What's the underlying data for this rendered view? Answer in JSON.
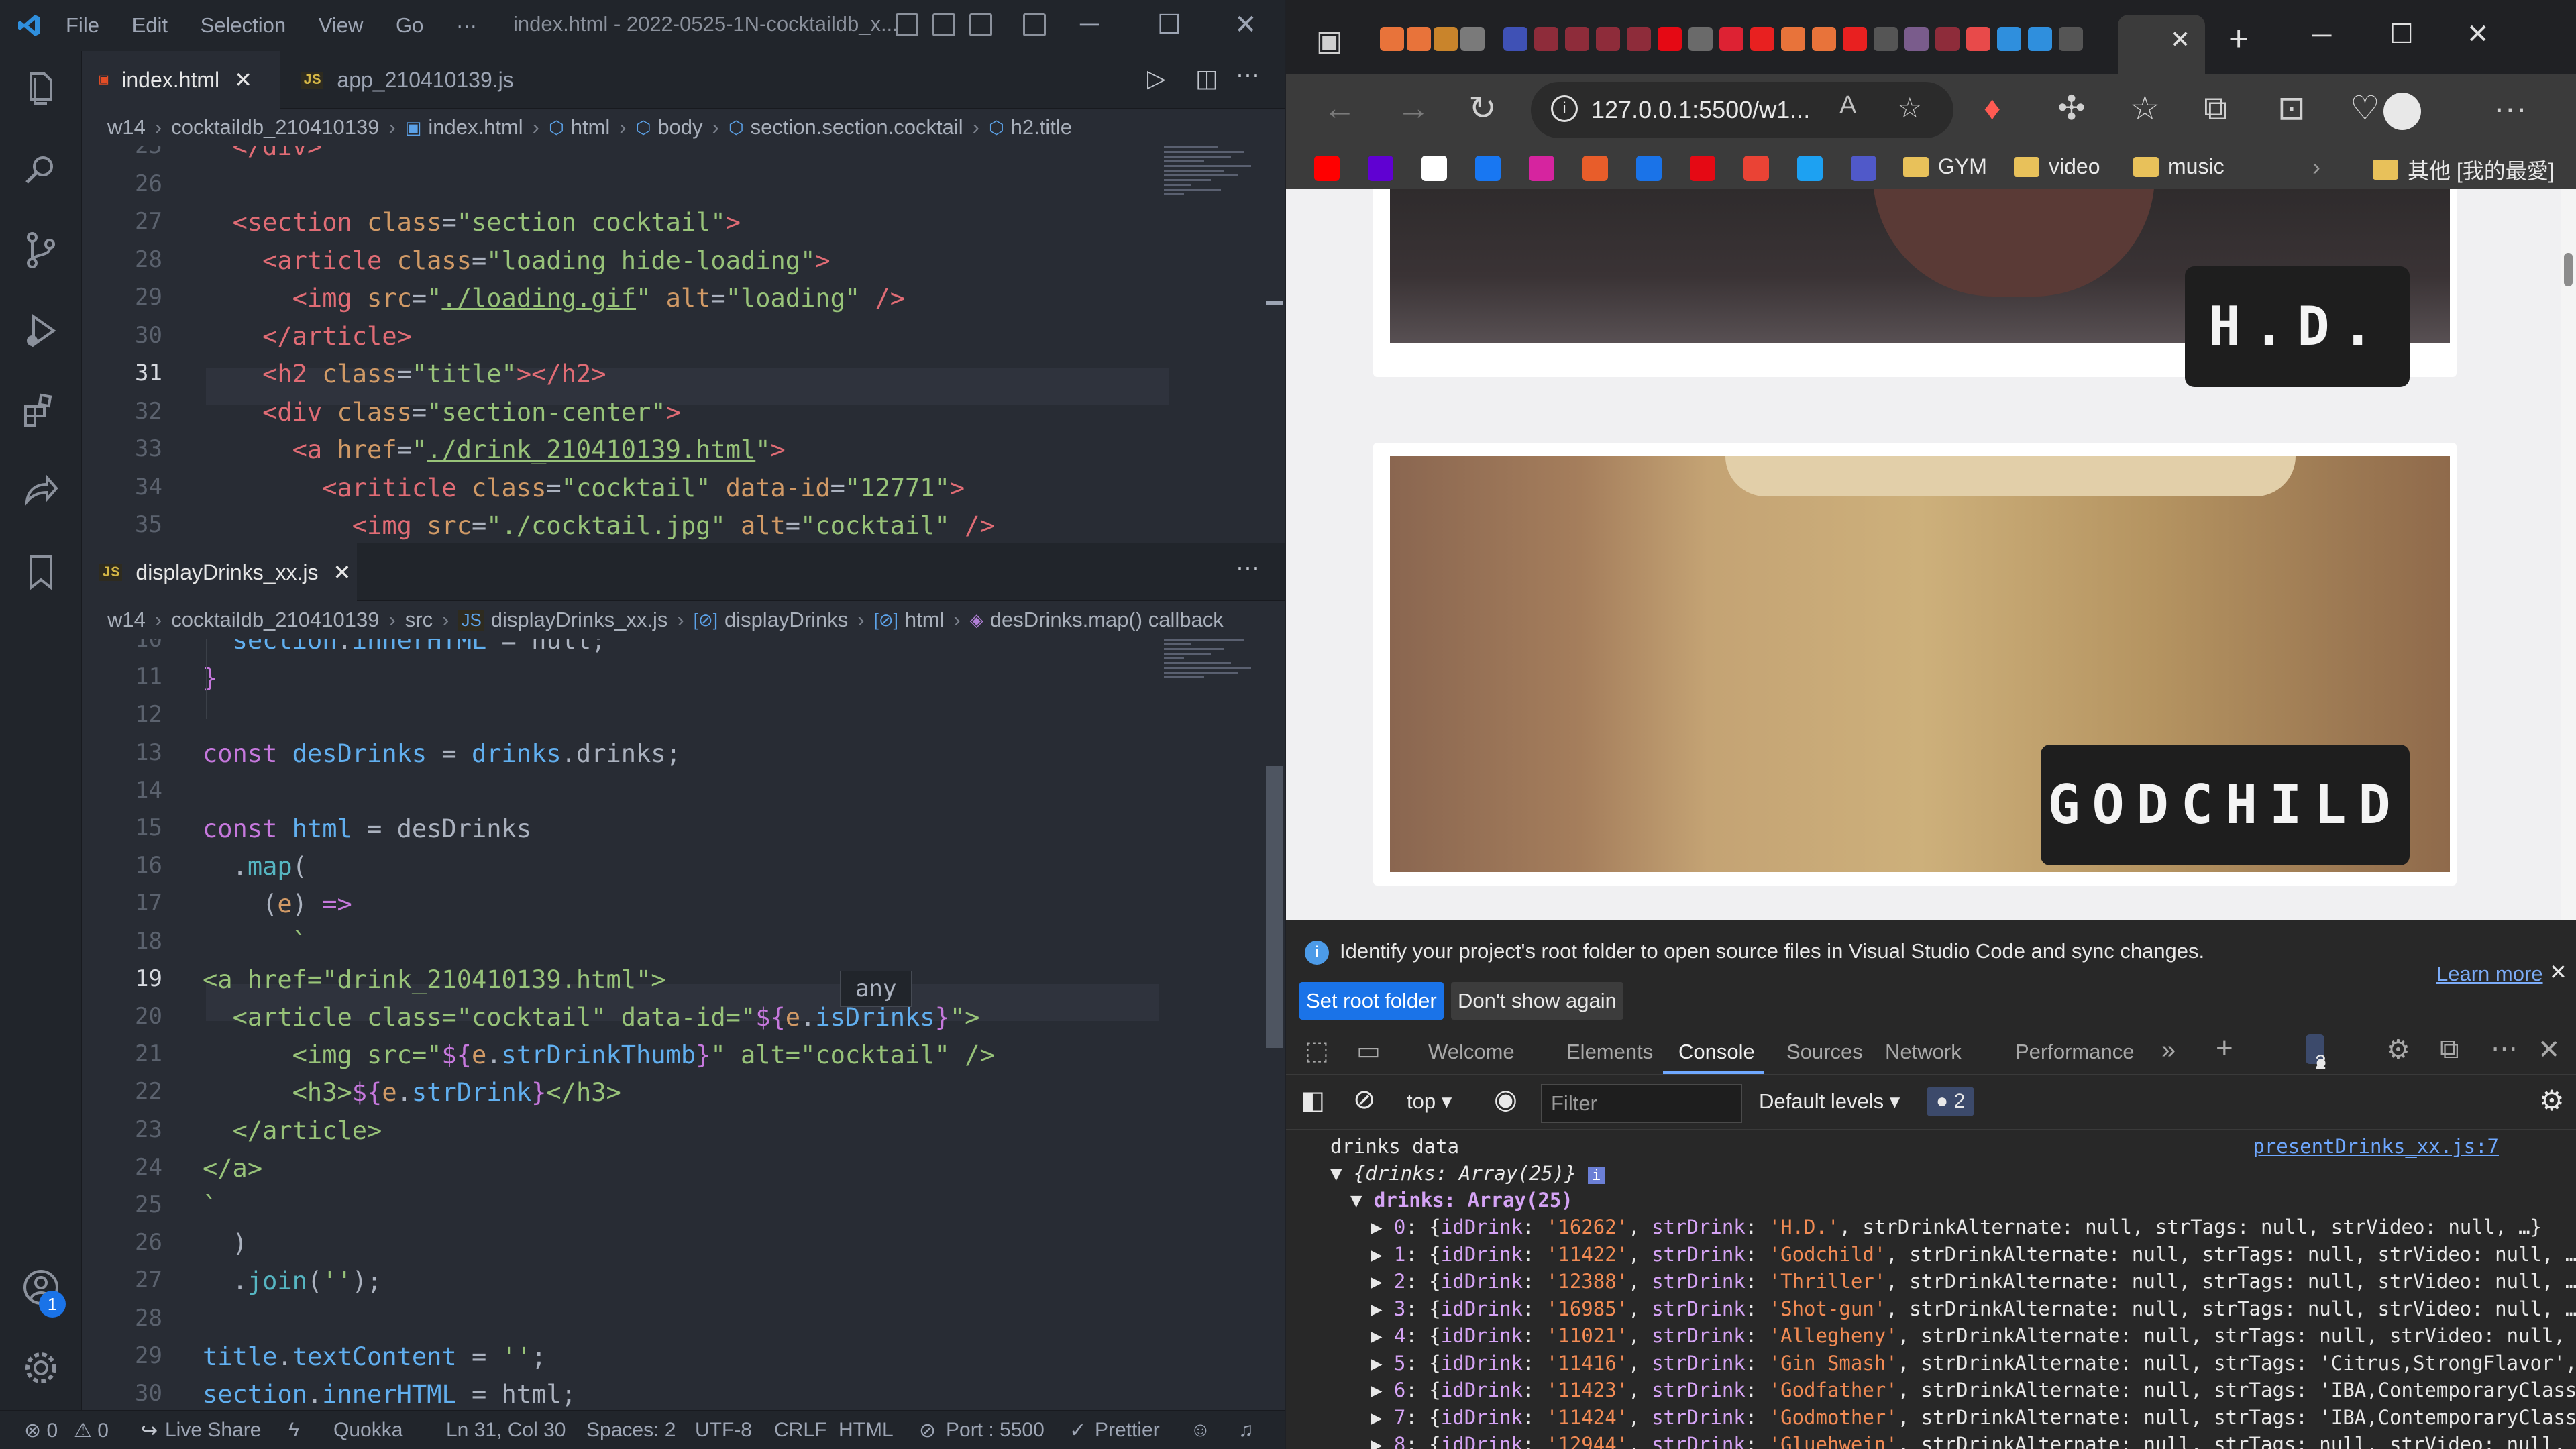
{
  "vscode": {
    "menu": [
      "File",
      "Edit",
      "Selection",
      "View",
      "Go",
      "···"
    ],
    "window_title": "index.html - 2022-0525-1N-cocktaildb_x...",
    "editor_top": {
      "tabs": [
        {
          "label": "index.html",
          "icon": "html5-icon",
          "active": true
        },
        {
          "label": "app_210410139.js",
          "icon": "js-icon",
          "active": false
        }
      ],
      "breadcrumb": [
        "w14",
        "cocktaildb_210410139",
        "index.html",
        "html",
        "body",
        "section.section.cocktail",
        "h2.title"
      ],
      "lines": [
        {
          "n": "25",
          "html": "  <span class='tag'>&lt;/div&gt;</span>"
        },
        {
          "n": "26",
          "html": ""
        },
        {
          "n": "27",
          "html": "  <span class='tag'>&lt;section</span> <span class='attr'>class</span>=<span class='str'>\"section cocktail\"</span><span class='tag'>&gt;</span>"
        },
        {
          "n": "28",
          "html": "    <span class='tag'>&lt;article</span> <span class='attr'>class</span>=<span class='str'>\"loading hide-loading\"</span><span class='tag'>&gt;</span>"
        },
        {
          "n": "29",
          "html": "      <span class='tag'>&lt;img</span> <span class='attr'>src</span>=<span class='str'>\"<span class='u'>./loading.gif</span>\"</span> <span class='attr'>alt</span>=<span class='str'>\"loading\"</span> <span class='tag'>/&gt;</span>"
        },
        {
          "n": "30",
          "html": "    <span class='tag'>&lt;/article&gt;</span>"
        },
        {
          "n": "31",
          "html": "    <span class='tag'>&lt;h2</span> <span class='attr'>class</span>=<span class='str'>\"title\"</span><span class='tag'>&gt;&lt;/h2&gt;</span>"
        },
        {
          "n": "32",
          "html": "    <span class='tag'>&lt;div</span> <span class='attr'>class</span>=<span class='str'>\"section-center\"</span><span class='tag'>&gt;</span>"
        },
        {
          "n": "33",
          "html": "      <span class='tag'>&lt;a</span> <span class='attr'>href</span>=<span class='str'>\"<span class='u'>./drink_210410139.html</span>\"</span><span class='tag'>&gt;</span>"
        },
        {
          "n": "34",
          "html": "        <span class='tag'>&lt;ariticle</span> <span class='attr'>class</span>=<span class='str'>\"cocktail\"</span> <span class='attr'>data-id</span>=<span class='str'>\"12771\"</span><span class='tag'>&gt;</span>"
        },
        {
          "n": "35",
          "html": "          <span class='tag'>&lt;img</span> <span class='attr'>src</span>=<span class='str'>\"./cocktail.jpg\"</span> <span class='attr'>alt</span>=<span class='str'>\"cocktail\"</span> <span class='tag'>/&gt;</span>"
        }
      ]
    },
    "editor_bottom": {
      "tab": {
        "label": "displayDrinks_xx.js",
        "icon": "js-icon"
      },
      "breadcrumb": [
        "w14",
        "cocktaildb_210410139",
        "src",
        "displayDrinks_xx.js",
        "displayDrinks",
        "html",
        "desDrinks.map() callback"
      ],
      "lines": [
        {
          "n": "10",
          "html": "  <span class='var'>section</span>.<span class='var'>innerHTML</span> = <span class='plain'>null</span>;"
        },
        {
          "n": "11",
          "html": "<span class='kw'>}</span>"
        },
        {
          "n": "12",
          "html": ""
        },
        {
          "n": "13",
          "html": "<span class='kw'>const</span> <span class='var'>desDrinks</span> = <span class='var'>drinks</span>.drinks;"
        },
        {
          "n": "14",
          "html": ""
        },
        {
          "n": "15",
          "html": "<span class='kw'>const</span> <span class='var'>html</span> = desDrinks"
        },
        {
          "n": "16",
          "html": "  .<span class='prop'>map</span>("
        },
        {
          "n": "17",
          "html": "    (<span class='attr'>e</span>) <span class='kw'>=&gt;</span>"
        },
        {
          "n": "18",
          "html": "      <span class='str'>`</span>"
        },
        {
          "n": "19",
          "html": "<span class='str'>&lt;a href=\"drink_210410139.html\"&gt;</span>"
        },
        {
          "n": "20",
          "html": "  <span class='str'>&lt;article class=\"cocktail\" data-id=\"</span><span class='kw'>${</span><span class='attr'>e</span>.<span class='var'>isDrinks</span><span class='kw'>}</span><span class='str'>\"&gt;</span>"
        },
        {
          "n": "21",
          "html": "      <span class='str'>&lt;img src=\"</span><span class='kw'>${</span><span class='attr'>e</span>.<span class='var'>strDrinkThumb</span><span class='kw'>}</span><span class='str'>\" alt=\"cocktail\" /&gt;</span>"
        },
        {
          "n": "22",
          "html": "      <span class='str'>&lt;h3&gt;</span><span class='kw'>${</span><span class='attr'>e</span>.<span class='var'>strDrink</span><span class='kw'>}</span><span class='str'>&lt;/h3&gt;</span>"
        },
        {
          "n": "23",
          "html": "  <span class='str'>&lt;/article&gt;</span>"
        },
        {
          "n": "24",
          "html": "<span class='str'>&lt;/a&gt;</span>"
        },
        {
          "n": "25",
          "html": "<span class='str'>`</span>"
        },
        {
          "n": "26",
          "html": "  )"
        },
        {
          "n": "27",
          "html": "  .<span class='prop'>join</span>(<span class='str'>''</span>);"
        },
        {
          "n": "28",
          "html": ""
        },
        {
          "n": "29",
          "html": "<span class='var'>title</span>.<span class='var'>textContent</span> = <span class='str'>''</span>;"
        },
        {
          "n": "30",
          "html": "<span class='var'>section</span>.<span class='var'>innerHTML</span> = html;"
        }
      ],
      "hover_text": "any"
    },
    "status": {
      "errors": "⊗ 0",
      "warnings": "⚠ 0",
      "live_share": "Live Share",
      "quokka": "Quokka",
      "position": "Ln 31, Col 30",
      "spaces": "Spaces: 2",
      "encoding": "UTF-8",
      "eol": "CRLF",
      "language": "HTML",
      "port": "Port : 5500",
      "prettier": "Prettier"
    },
    "accounts_badge": "1"
  },
  "browser": {
    "address": "127.0.0.1:5500/w1...",
    "bookmarks": {
      "folders": [
        "GYM",
        "video",
        "music"
      ],
      "other": "其他 [我的最愛]"
    },
    "cards": [
      {
        "title": "H.D."
      },
      {
        "title": "GODCHILD"
      }
    ],
    "infobar": {
      "message": "Identify your project's root folder to open source files in Visual Studio Code and sync changes.",
      "learn_more": "Learn more",
      "set_root": "Set root folder",
      "dont_show": "Don't show again"
    },
    "devtools_tabs": [
      "Welcome",
      "Elements",
      "Console",
      "Sources",
      "Network",
      "Performance"
    ],
    "active_tab": "Console",
    "issues_count": "2",
    "context": "top",
    "filter_placeholder": "Filter",
    "levels": "Default levels",
    "console": {
      "header": "drinks data",
      "source_link": "presentDrinks_xx.js:7",
      "object_line": "{drinks: Array(25)}",
      "array_line": "drinks: Array(25)",
      "rows": [
        {
          "i": "0",
          "id": "'16262'",
          "name": "'H.D.'",
          "rest": ", strDrinkAlternate: null, strTags: null, strVideo: null, …}"
        },
        {
          "i": "1",
          "id": "'11422'",
          "name": "'Godchild'",
          "rest": ", strDrinkAlternate: null, strTags: null, strVideo: null, …"
        },
        {
          "i": "2",
          "id": "'12388'",
          "name": "'Thriller'",
          "rest": ", strDrinkAlternate: null, strTags: null, strVideo: null, …"
        },
        {
          "i": "3",
          "id": "'16985'",
          "name": "'Shot-gun'",
          "rest": ", strDrinkAlternate: null, strTags: null, strVideo: null, …"
        },
        {
          "i": "4",
          "id": "'11021'",
          "name": "'Allegheny'",
          "rest": ", strDrinkAlternate: null, strTags: null, strVideo: null,"
        },
        {
          "i": "5",
          "id": "'11416'",
          "name": "'Gin Smash'",
          "rest": ", strDrinkAlternate: null, strTags: 'Citrus,StrongFlavor',"
        },
        {
          "i": "6",
          "id": "'11423'",
          "name": "'Godfather'",
          "rest": ", strDrinkAlternate: null, strTags: 'IBA,ContemporaryClass"
        },
        {
          "i": "7",
          "id": "'11424'",
          "name": "'Godmother'",
          "rest": ", strDrinkAlternate: null, strTags: 'IBA,ContemporaryClass"
        },
        {
          "i": "8",
          "id": "'12944'",
          "name": "'Gluehwein'",
          "rest": ", strDrinkAlternate: null, strTags: null, strVideo: null,"
        }
      ]
    }
  },
  "colors": {
    "vscode_bg": "#21252b",
    "editor_bg": "#282c34",
    "accent": "#6fa8ff"
  }
}
